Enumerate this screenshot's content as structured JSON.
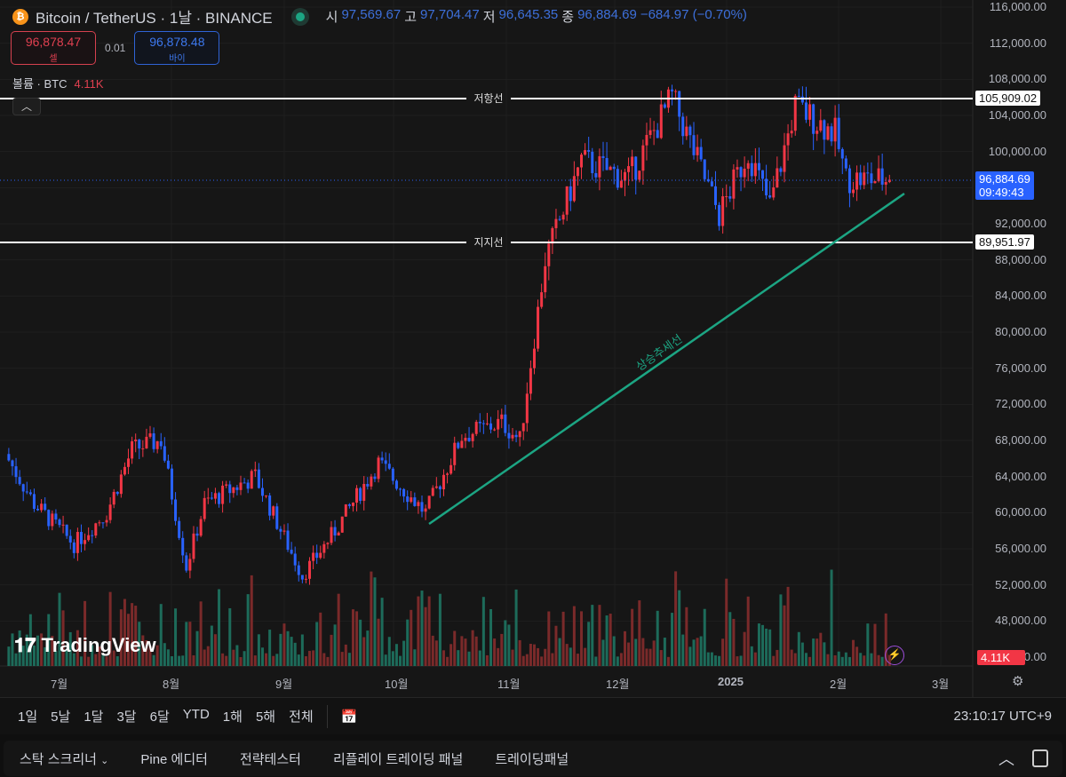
{
  "header": {
    "symbol": "Bitcoin / TetherUS · 1날 · BINANCE",
    "open_label": "시",
    "open": "97,569.67",
    "high_label": "고",
    "high": "97,704.47",
    "low_label": "저",
    "low": "96,645.35",
    "close_label": "종",
    "close": "96,884.69",
    "change": "−684.97 (−0.70%)"
  },
  "trade": {
    "sell_price": "96,878.47",
    "sell_label": "셀",
    "spread": "0.01",
    "buy_price": "96,878.48",
    "buy_label": "바이"
  },
  "volume": {
    "label": "볼륨 · BTC",
    "value": "4.11K"
  },
  "price_axis": [
    "116,000.00",
    "112,000.00",
    "108,000.00",
    "104,000.00",
    "100,000.00",
    "92,000.00",
    "88,000.00",
    "84,000.00",
    "80,000.00",
    "76,000.00",
    "72,000.00",
    "68,000.00",
    "64,000.00",
    "60,000.00",
    "56,000.00",
    "52,000.00",
    "48,000.00",
    "44,000.00"
  ],
  "lines": {
    "resistance_label": "저항선",
    "resistance_price": "105,909.02",
    "support_label": "지지선",
    "support_price": "89,951.97",
    "trend_label": "상승추세선"
  },
  "last_price": {
    "price": "96,884.69",
    "countdown": "09:49:43"
  },
  "volume_tag": "4.11K",
  "time_axis": [
    "7월",
    "8월",
    "9월",
    "10월",
    "11월",
    "12월",
    "2025",
    "2월",
    "3월"
  ],
  "ranges": [
    "1일",
    "5날",
    "1달",
    "3달",
    "6달",
    "YTD",
    "1해",
    "5해",
    "전체"
  ],
  "clock": "23:10:17 UTC+9",
  "logo": "TradingView",
  "bottom_tabs": [
    "스탁 스크리너",
    "Pine 에디터",
    "전략테스터",
    "리플레이 트레이딩 패널",
    "트레이딩패널"
  ],
  "colors": {
    "up": "#f23645",
    "down": "#2962ff",
    "vol_up": "#7a2a2a",
    "vol_down": "#1d6b5a",
    "trend": "#1ca583",
    "last": "#2962ff"
  },
  "chart_data": {
    "type": "candlestick",
    "ylim": [
      44000,
      116000
    ],
    "keypoints": [
      [
        -15,
        66500
      ],
      [
        -7,
        61000
      ],
      [
        4,
        56500
      ],
      [
        13,
        60000
      ],
      [
        20,
        67000
      ],
      [
        28,
        68000
      ],
      [
        35,
        54000
      ],
      [
        40,
        61000
      ],
      [
        54,
        64000
      ],
      [
        67,
        53000
      ],
      [
        76,
        58000
      ],
      [
        88,
        65500
      ],
      [
        101,
        60000
      ],
      [
        111,
        68500
      ],
      [
        122,
        70000
      ],
      [
        127,
        68000
      ],
      [
        134,
        88000
      ],
      [
        144,
        99000
      ],
      [
        157,
        97000
      ],
      [
        169,
        106000
      ],
      [
        182,
        93000
      ],
      [
        190,
        100000
      ],
      [
        196,
        94000
      ],
      [
        203,
        105000
      ],
      [
        214,
        102000
      ],
      [
        217,
        97000
      ],
      [
        229,
        96885
      ]
    ]
  }
}
